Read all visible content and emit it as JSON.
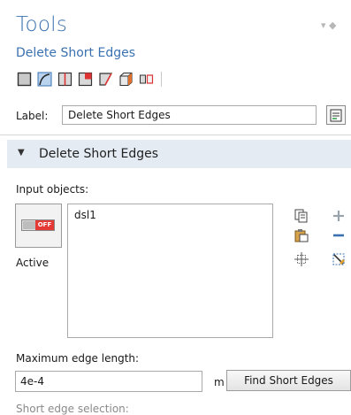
{
  "panel": {
    "title": "Tools",
    "subtitle": "Delete Short Edges"
  },
  "label_field": {
    "label": "Label:",
    "value": "Delete Short Edges"
  },
  "section": {
    "title": "Delete Short Edges"
  },
  "input_objects": {
    "label": "Input objects:",
    "active_badge": "OFF",
    "active_label": "Active",
    "items": [
      "dsl1"
    ]
  },
  "max_edge_length": {
    "label": "Maximum edge length:",
    "value": "4e-4",
    "unit": "m",
    "find_button": "Find Short Edges"
  },
  "short_edge_selection": {
    "label": "Short edge selection:"
  },
  "colors": {
    "accent": "#3a71b0",
    "section_bg": "#e4ebf3",
    "off_badge": "#e53935"
  }
}
